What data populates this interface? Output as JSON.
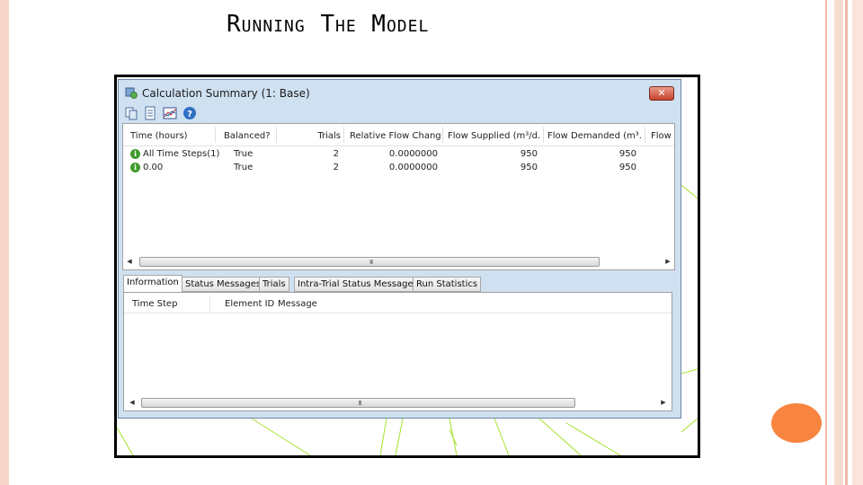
{
  "slide": {
    "title": "Running The Model"
  },
  "window": {
    "title": "Calculation Summary (1: Base)",
    "close_label": "✕",
    "toolbar": [
      "copy-icon",
      "report-icon",
      "graph-icon",
      "help-icon"
    ]
  },
  "results": {
    "columns": [
      "Time (hours)",
      "Balanced?",
      "Trials",
      "Relative Flow Change",
      "Flow Supplied (m³/d...",
      "Flow Demanded (m³...",
      "Flow S"
    ],
    "rows": [
      {
        "time": "All Time Steps(1)",
        "balanced": "True",
        "trials": "2",
        "change": "0.0000000",
        "supplied": "950",
        "demanded": "950"
      },
      {
        "time": "0.00",
        "balanced": "True",
        "trials": "2",
        "change": "0.0000000",
        "supplied": "950",
        "demanded": "950"
      }
    ],
    "scroll_grip": "III"
  },
  "tabs": [
    "Information",
    "Status Messages",
    "Trials",
    "Intra-Trial Status Messages",
    "Run Statistics"
  ],
  "messages": {
    "columns": [
      "Time Step",
      "Element ID",
      "Message"
    ],
    "scroll_grip": "III"
  },
  "colors": {
    "accent": "#f7853f",
    "network_lines": "#a6e22e"
  }
}
